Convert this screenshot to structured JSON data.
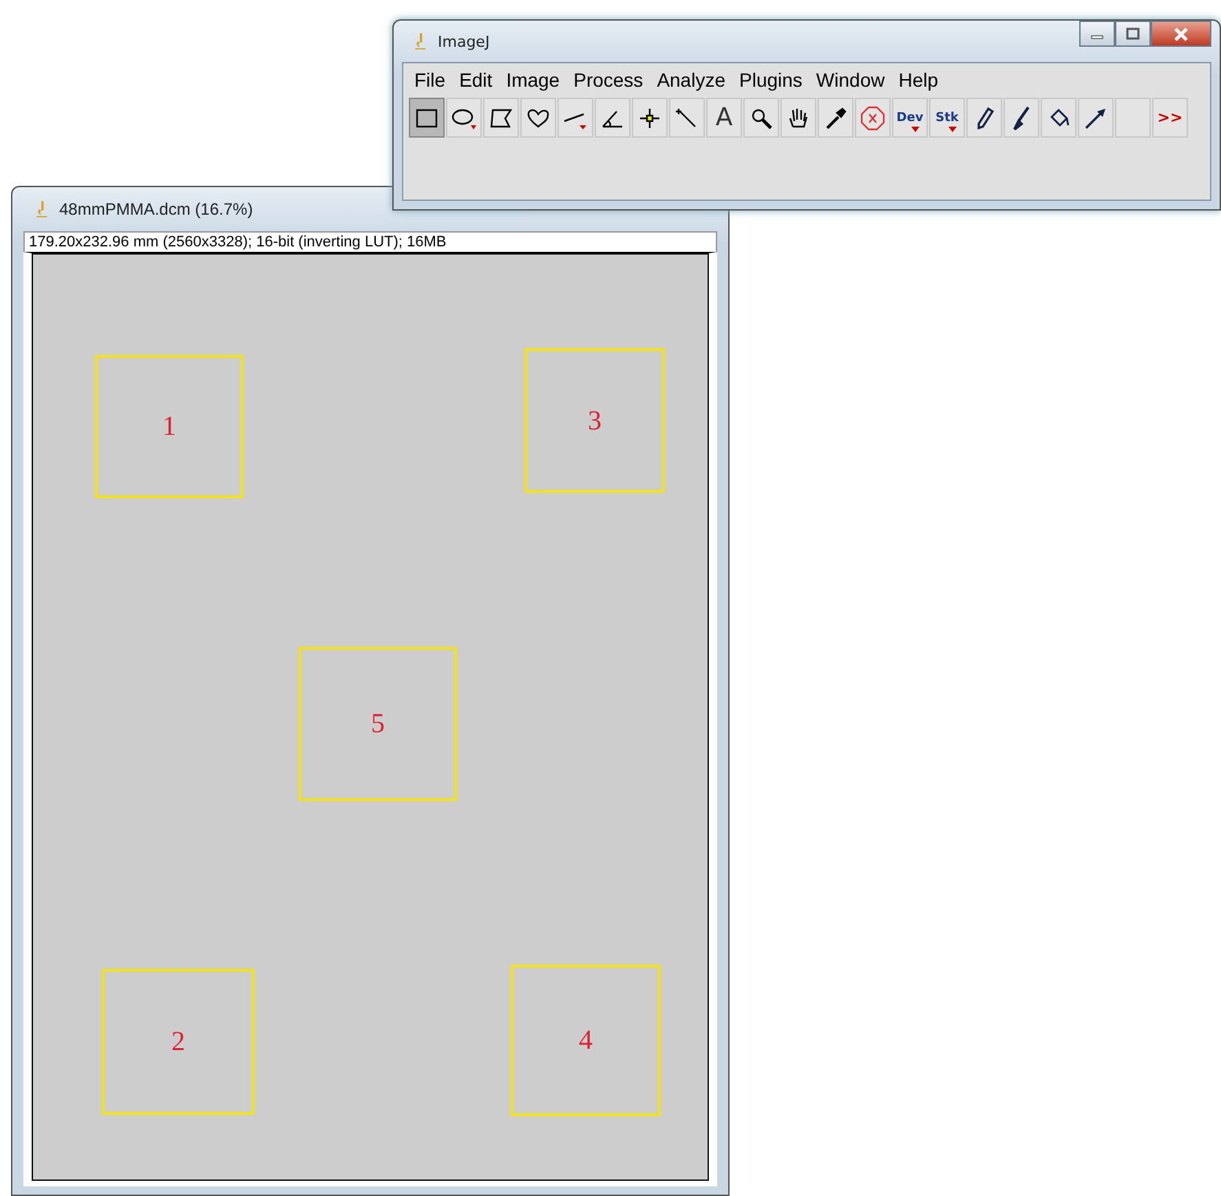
{
  "image_window": {
    "title": "48mmPMMA.dcm (16.7%)",
    "info": "179.20x232.96 mm (2560x3328); 16-bit (inverting LUT); 16MB",
    "rois": [
      {
        "label": "1"
      },
      {
        "label": "3"
      },
      {
        "label": "5"
      },
      {
        "label": "2"
      },
      {
        "label": "4"
      }
    ]
  },
  "imagej_window": {
    "title": "ImageJ",
    "menu": [
      "File",
      "Edit",
      "Image",
      "Process",
      "Analyze",
      "Plugins",
      "Window",
      "Help"
    ],
    "tools": [
      {
        "kind": "rectangle",
        "selected": true
      },
      {
        "kind": "oval",
        "selected": false
      },
      {
        "kind": "polygon",
        "selected": false
      },
      {
        "kind": "freehand",
        "selected": false
      },
      {
        "kind": "line",
        "selected": false
      },
      {
        "kind": "angle",
        "selected": false
      },
      {
        "kind": "point",
        "selected": false
      },
      {
        "kind": "wand",
        "selected": false
      },
      {
        "kind": "text",
        "label": "A",
        "selected": false
      },
      {
        "kind": "magnifier",
        "selected": false
      },
      {
        "kind": "hand",
        "selected": false
      },
      {
        "kind": "dropper",
        "selected": false
      },
      {
        "kind": "stop",
        "selected": false
      },
      {
        "kind": "text",
        "label": "Dev",
        "selected": false,
        "caret": true
      },
      {
        "kind": "text",
        "label": "Stk",
        "selected": false,
        "caret": true
      },
      {
        "kind": "pencil",
        "selected": false
      },
      {
        "kind": "brush",
        "selected": false
      },
      {
        "kind": "fill",
        "selected": false
      },
      {
        "kind": "arrow",
        "selected": false
      },
      {
        "kind": "blank",
        "selected": false
      },
      {
        "kind": "text",
        "label": ">>",
        "selected": false
      }
    ]
  }
}
